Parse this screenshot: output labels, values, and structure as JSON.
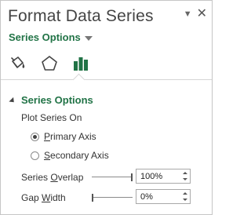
{
  "pane": {
    "title": "Format Data Series",
    "pin_icon": "pin-dropdown-icon",
    "close_icon": "close-icon"
  },
  "series_dropdown": {
    "label": "Series Options",
    "accent_color": "#217346"
  },
  "tabs": [
    {
      "name": "Fill & Line",
      "icon": "paint-bucket-icon"
    },
    {
      "name": "Effects",
      "icon": "pentagon-icon"
    },
    {
      "name": "Series Options",
      "icon": "bar-chart-icon",
      "selected": true
    }
  ],
  "section": {
    "label": "Series Options",
    "expanded": true
  },
  "plot_series_on": {
    "label": "Plot Series On",
    "options": [
      {
        "label_pre": "",
        "label_key": "P",
        "label_post": "rimary Axis",
        "checked": true
      },
      {
        "label_pre": "",
        "label_key": "S",
        "label_post": "econdary Axis",
        "checked": false
      }
    ]
  },
  "series_overlap": {
    "label_pre": "Series ",
    "label_key": "O",
    "label_post": "verlap",
    "value": "100%",
    "slider_fraction": 1.0
  },
  "gap_width": {
    "label_pre": "Gap ",
    "label_key": "W",
    "label_post": "idth",
    "value": "0%",
    "slider_fraction": 0.0
  }
}
